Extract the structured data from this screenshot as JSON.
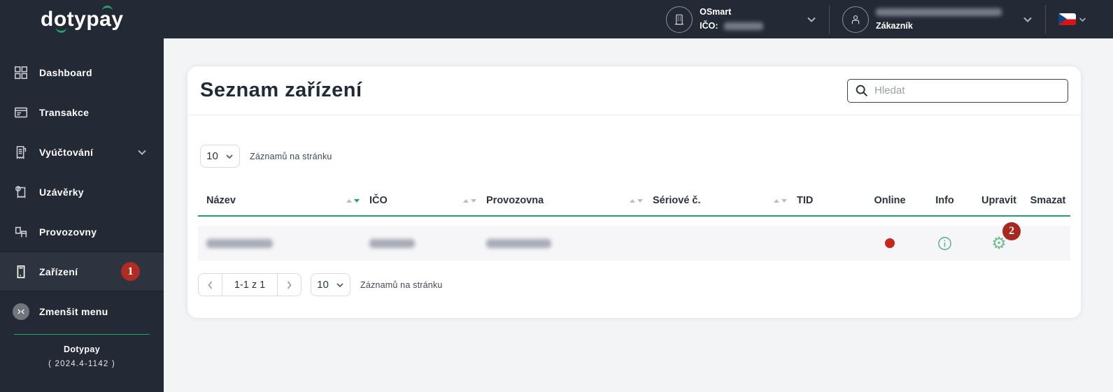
{
  "topbar": {
    "logo_text": "dotypay",
    "company": {
      "name": "OSmart",
      "ico_label": "IČO:"
    },
    "user": {
      "role_label": "Zákazník"
    }
  },
  "sidebar": {
    "items": [
      {
        "label": "Dashboard",
        "icon": "dashboard-grid-icon"
      },
      {
        "label": "Transakce",
        "icon": "transactions-table-icon"
      },
      {
        "label": "Vyúčtování",
        "icon": "billing-receipt-icon",
        "expandable": true
      },
      {
        "label": "Uzávěrky",
        "icon": "closures-receipt-icon"
      },
      {
        "label": "Provozovny",
        "icon": "stores-icon"
      },
      {
        "label": "Zařízení",
        "icon": "device-terminal-icon",
        "active": true,
        "badge": "1"
      }
    ],
    "collapse_label": "Zmenšit menu",
    "brand": "Dotypay",
    "version": "( 2024.4-1142 )"
  },
  "main": {
    "title": "Seznam zařízení",
    "search_placeholder": "Hledat",
    "page_size": "10",
    "records_per_page_label": "Záznamů na stránku",
    "table": {
      "columns": [
        {
          "label": "Název",
          "sortable": true,
          "sort": "desc"
        },
        {
          "label": "IČO",
          "sortable": true
        },
        {
          "label": "Provozovna",
          "sortable": true
        },
        {
          "label": "Sériové č.",
          "sortable": true
        },
        {
          "label": "TID"
        },
        {
          "label": "Online"
        },
        {
          "label": "Info"
        },
        {
          "label": "Upravit"
        },
        {
          "label": "Smazat"
        }
      ],
      "row": {
        "name_redacted": true,
        "ico_redacted": true,
        "provozovna_redacted": true,
        "online_status": "red-dot",
        "gear_badge": "2"
      }
    },
    "pagination": {
      "range": "1-1 z 1",
      "page_size": "10",
      "records_per_page_label": "Záznamů na stránku"
    }
  },
  "colors": {
    "topbar_dark": "#242a35",
    "accent_green": "#21a464",
    "table_header_green": "#27a066",
    "badge_red": "#b02b20",
    "online_dot_red": "#c5281c"
  }
}
